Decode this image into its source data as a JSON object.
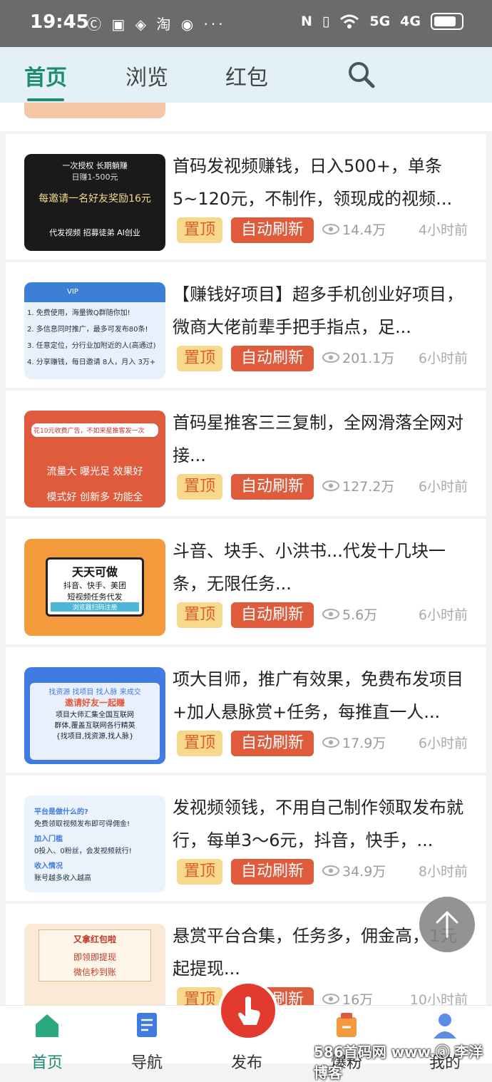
{
  "status_bar": {
    "time": "19:45",
    "app_icons": "Ⓒ ▣ ◈ 淘 ◉ ···",
    "network": "5G",
    "network2": "4G",
    "nfc": "N",
    "vibrate": "▯"
  },
  "nav": {
    "tabs": [
      "首页",
      "浏览",
      "红包"
    ]
  },
  "items": [
    {
      "title": "首码发视频赚钱，日入500+，单条5~120元，不制作，领现成的视频...",
      "badge_top": "置顶",
      "badge_refresh": "自动刷新",
      "views": "14.4万",
      "time": "4小时前",
      "thumb_lines": [
        "一次授权 长期躺赚",
        "日赚1-500元",
        "每邀请一名好友奖励16元",
        "代发视频  招募徒弟  AI创业"
      ]
    },
    {
      "title": "【赚钱好项目】超多手机创业好项目，微商大佬前辈手把手指点，足...",
      "badge_top": "置顶",
      "badge_refresh": "自动刷新",
      "views": "201.1万",
      "time": "6小时前",
      "thumb_lines": [
        "VIP",
        "1. 免费使用，海量微Q群随你加!",
        "2. 多信息同时推广，最多可发布80条!",
        "3. 任意定位，分行业加附近的人(高通过)",
        "4. 分享赚钱，每日邀请 8人，月入 3万+"
      ]
    },
    {
      "title": "首码星推客三三复制，全网滑落全网对接...",
      "badge_top": "置顶",
      "badge_refresh": "自动刷新",
      "views": "127.2万",
      "time": "6小时前",
      "thumb_lines": [
        "花10元收费广告，不如来星推客发一次",
        "流量大  曝光足  效果好",
        "模式好  创新多  功能全"
      ]
    },
    {
      "title": "斗音、块手、小洪书...代发十几块一条，无限任务...",
      "badge_top": "置顶",
      "badge_refresh": "自动刷新",
      "views": "5.6万",
      "time": "6小时前",
      "thumb_lines": [
        "天天可做",
        "抖音、快手、美团",
        "短视频任务代发",
        "浏览器扫码注册"
      ]
    },
    {
      "title": "项大目师，推广有效果，免费布发项目+加人悬脉赏+任务，每推直一人...",
      "badge_top": "置顶",
      "badge_refresh": "自动刷新",
      "views": "17.9万",
      "time": "6小时前",
      "thumb_lines": [
        "找资源 找项目 找人脉 来成交",
        "邀请好友一起赚",
        "项目大师汇集全国互联网",
        "群体,覆盖互联网各行精英",
        "{找项目,找资源,找人脉}"
      ]
    },
    {
      "title": "发视频领钱，不用自己制作领取发布就行，每单3～6元，抖音，快手，...",
      "badge_top": "置顶",
      "badge_refresh": "自动刷新",
      "views": "34.9万",
      "time": "8小时前",
      "thumb_lines": [
        "平台是做什么的?",
        "免费领取视频发布即可得佣金!",
        "加入门槛",
        "0投入、0粉丝，会发视频就行!",
        "收入情况",
        "账号越多收入越高"
      ]
    },
    {
      "title": "悬赏平台合集，任务多，佣金高，1元起提现...",
      "badge_top": "置顶",
      "badge_refresh": "自动刷新",
      "views": "16万",
      "time": "10小时前",
      "thumb_lines": [
        "又拿红包啦",
        "即领即提现",
        "微信秒到账"
      ]
    }
  ],
  "bottom_nav": [
    "首页",
    "导航",
    "发布",
    "爆粉",
    "我的"
  ],
  "watermark": "586首码网 www.ⓐ 李洋博客",
  "colors": {
    "accent": "#1d8a74",
    "refresh": "#e05a3c",
    "top": "#f6d98a"
  }
}
